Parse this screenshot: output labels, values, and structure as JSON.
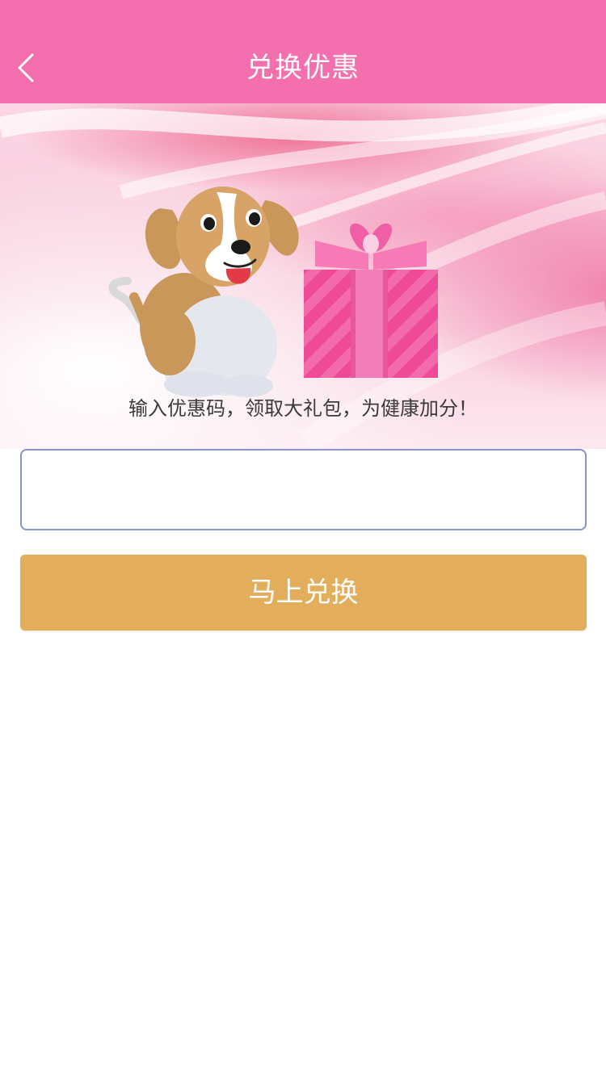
{
  "header": {
    "title": "兑换优惠",
    "back_icon": "chevron-left-icon"
  },
  "banner": {
    "slogan": "输入优惠码，领取大礼包，为健康加分！",
    "illustrations": [
      "beagle-dog-illustration",
      "gift-box-illustration"
    ]
  },
  "form": {
    "code_input_value": "",
    "code_input_placeholder": "",
    "submit_label": "马上兑换"
  },
  "colors": {
    "header_bg": "#f46fae",
    "button_bg": "#e2ae5c",
    "input_border": "#8a94c8",
    "gift_box": "#ee4a98"
  }
}
